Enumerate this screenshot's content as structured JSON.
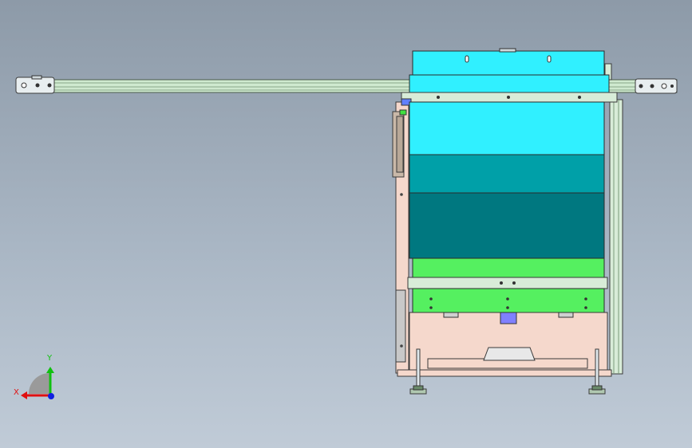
{
  "viewport": {
    "background_top": "#8d9aa8",
    "background_bottom": "#c0cbd7"
  },
  "colors": {
    "rail": "#cfe9cf",
    "rail_edge": "#4a5a4a",
    "hopper_top": "#30f0ff",
    "hopper_mid": "#00a0a8",
    "hopper_low": "#007880",
    "tray": "#55f060",
    "tray_dark": "#3ac848",
    "base": "#f5d8cc",
    "frame": "#d8ecd8",
    "outline": "#3a3a3a"
  },
  "triad": {
    "x_label": "X",
    "y_label": "Y",
    "x_color": "#e01010",
    "y_color": "#10c010",
    "z_color": "#1020e0"
  }
}
